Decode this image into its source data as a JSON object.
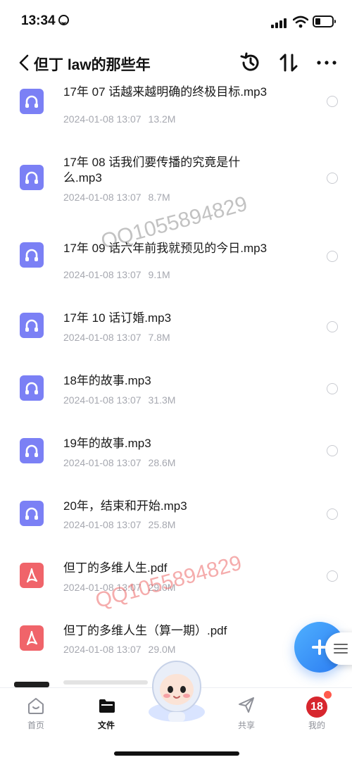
{
  "status_bar": {
    "time": "13:34"
  },
  "header": {
    "title": "但丁 law的那些年"
  },
  "files": [
    {
      "name": "17年 07 话越来越明确的终极目标.mp3",
      "date": "2024-01-08 13:07",
      "size": "13.2M",
      "type": "audio"
    },
    {
      "name": "17年 08 话我们要传播的究竟是什么.mp3",
      "date": "2024-01-08 13:07",
      "size": "8.7M",
      "type": "audio"
    },
    {
      "name": "17年 09 话六年前我就预见的今日.mp3",
      "date": "2024-01-08 13:07",
      "size": "9.1M",
      "type": "audio"
    },
    {
      "name": "17年 10 话订婚.mp3",
      "date": "2024-01-08 13:07",
      "size": "7.8M",
      "type": "audio"
    },
    {
      "name": "18年的故事.mp3",
      "date": "2024-01-08 13:07",
      "size": "31.3M",
      "type": "audio"
    },
    {
      "name": "19年的故事.mp3",
      "date": "2024-01-08 13:07",
      "size": "28.6M",
      "type": "audio"
    },
    {
      "name": "20年，结束和开始.mp3",
      "date": "2024-01-08 13:07",
      "size": "25.8M",
      "type": "audio"
    },
    {
      "name": "但丁的多维人生.pdf",
      "date": "2024-01-08 13:07",
      "size": "29.0M",
      "type": "pdf"
    },
    {
      "name": "但丁的多维人生（算一期）.pdf",
      "date": "2024-01-08 13:07",
      "size": "29.0M",
      "type": "pdf"
    }
  ],
  "watermarks": {
    "gray": "QQ1055894829",
    "red": "QQ1055894829"
  },
  "tabbar": {
    "home": "首页",
    "files": "文件",
    "share": "共享",
    "mine": "我的",
    "badge": "18"
  },
  "colors": {
    "audio_icon": "#7b80f5",
    "pdf_icon": "#f0646a",
    "fab": "#2b7bf1"
  }
}
